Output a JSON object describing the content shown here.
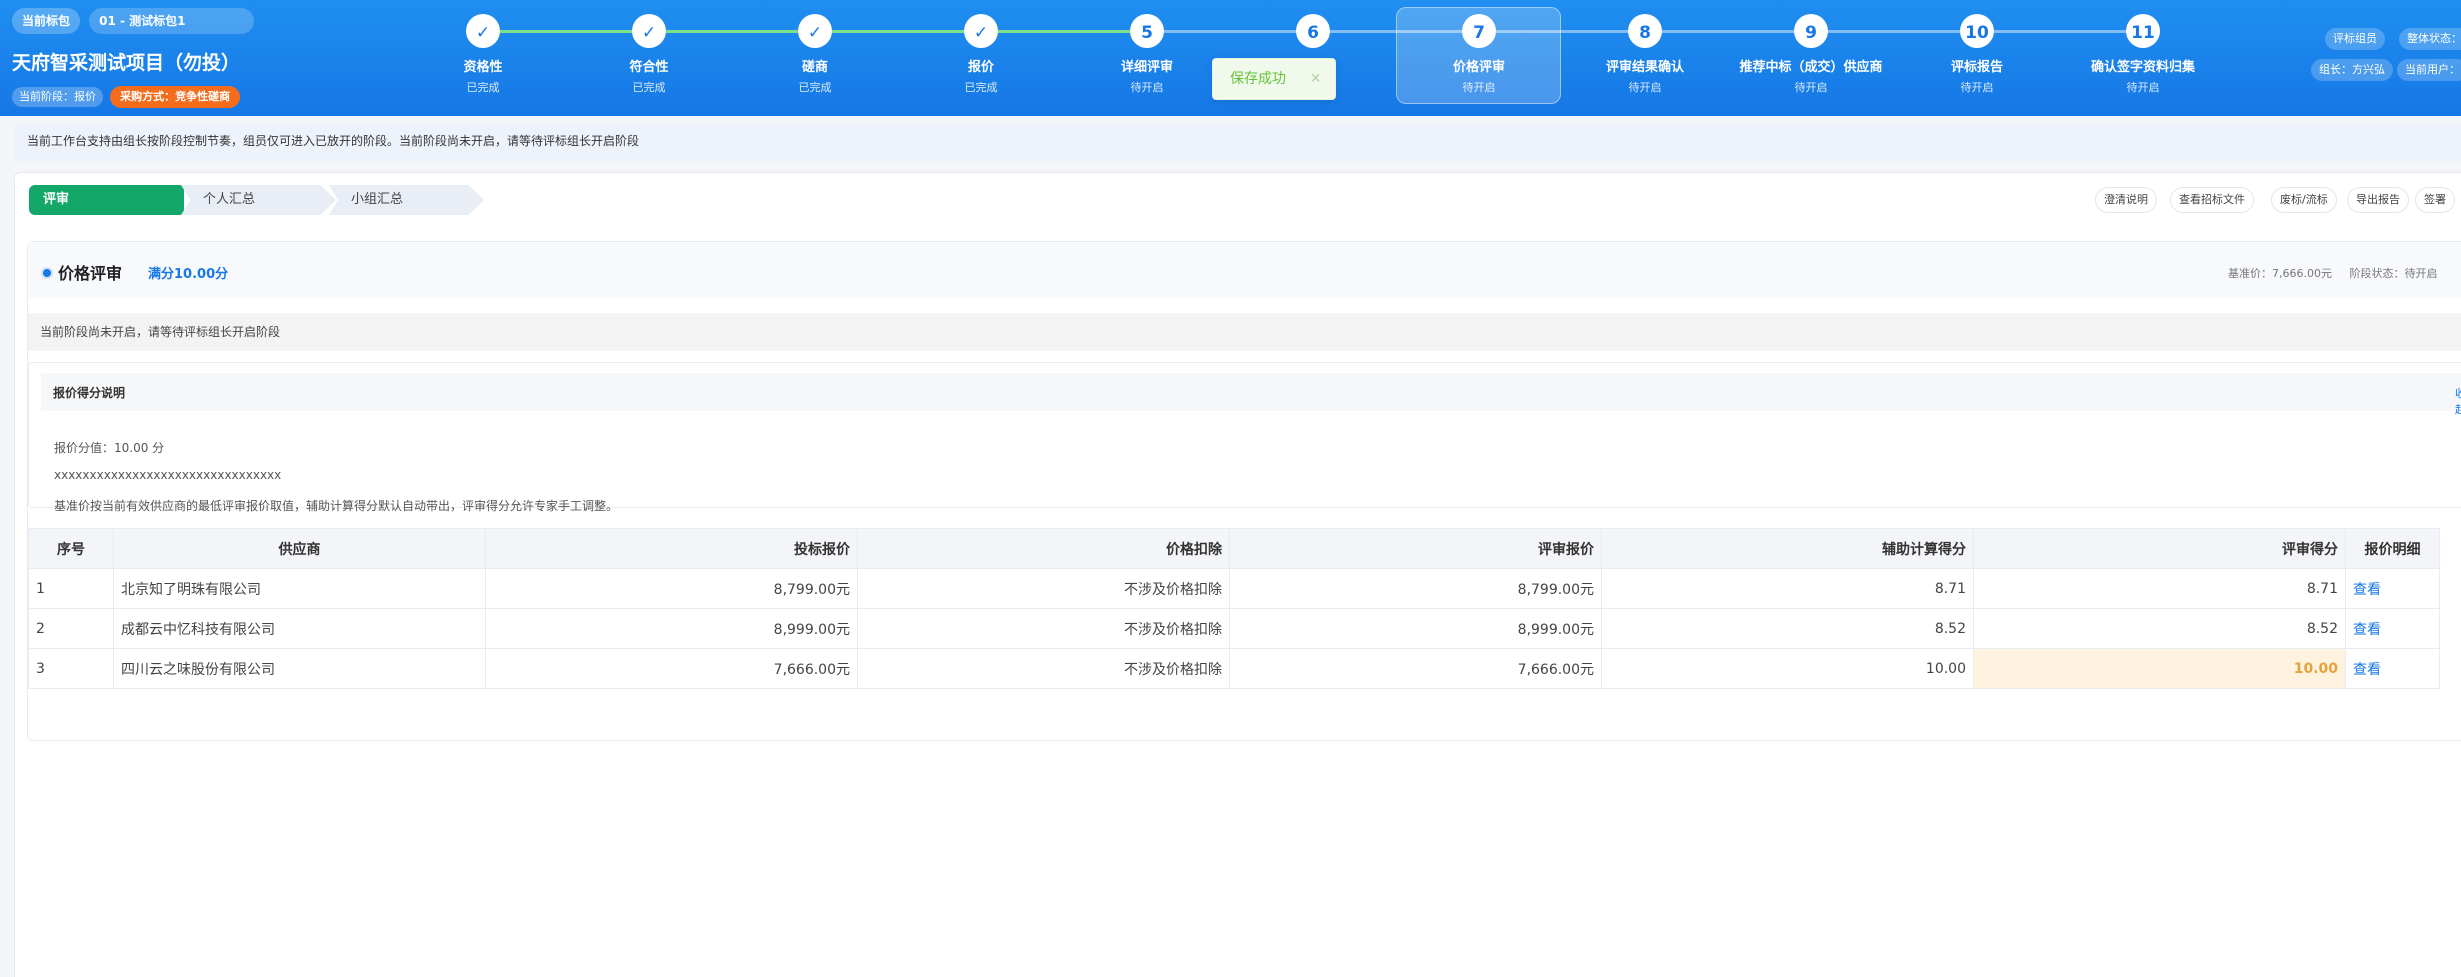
{
  "header": {
    "stage_tag": "当前标包",
    "package_label": "01 - 测试标包1",
    "project_title": "天府智采测试项目（勿投）",
    "current_stage": "当前阶段：报价",
    "method": "采购方式：竞争性磋商",
    "right": {
      "role": "评标组员",
      "overall_status": "整体状态：",
      "leader": "组长：方兴弘",
      "current_user": "当前用户："
    }
  },
  "steps": [
    {
      "num": "✓",
      "name": "资格性",
      "status": "已完成",
      "done": true
    },
    {
      "num": "✓",
      "name": "符合性",
      "status": "已完成",
      "done": true
    },
    {
      "num": "✓",
      "name": "磋商",
      "status": "已完成",
      "done": true
    },
    {
      "num": "✓",
      "name": "报价",
      "status": "已完成",
      "done": true
    },
    {
      "num": "5",
      "name": "详细评审",
      "status": "待开启",
      "done": false
    },
    {
      "num": "6",
      "name": "",
      "status": "",
      "done": false
    },
    {
      "num": "7",
      "name": "价格评审",
      "status": "待开启",
      "done": false
    },
    {
      "num": "8",
      "name": "评审结果确认",
      "status": "待开启",
      "done": false
    },
    {
      "num": "9",
      "name": "推荐中标（成交）供应商",
      "status": "待开启",
      "done": false
    },
    {
      "num": "10",
      "name": "评标报告",
      "status": "待开启",
      "done": false
    },
    {
      "num": "11",
      "name": "确认签字资料归集",
      "status": "待开启",
      "done": false
    }
  ],
  "toast": {
    "text": "保存成功",
    "close": "×"
  },
  "notice": "当前工作台支持由组长按阶段控制节奏，组员仅可进入已放开的阶段。当前阶段尚未开启，请等待评标组长开启阶段",
  "tabs": [
    "评审",
    "个人汇总",
    "小组汇总"
  ],
  "actions": [
    "澄清说明",
    "查看招标文件",
    "废标/流标",
    "导出报告",
    "签署"
  ],
  "section": {
    "title": "价格评审",
    "score": "满分10.00分",
    "base_price": "基准价：7,666.00元",
    "stage_status": "阶段状态：待开启",
    "warning": "当前阶段尚未开启，请等待评标组长开启阶段"
  },
  "explain": {
    "title": "报价得分说明",
    "collapse": "收起",
    "lines": [
      "报价分值：10.00 分",
      "xxxxxxxxxxxxxxxxxxxxxxxxxxxxxxxx",
      "基准价按当前有效供应商的最低评审报价取值，辅助计算得分默认自动带出，评审得分允许专家手工调整。"
    ]
  },
  "table": {
    "columns": [
      "序号",
      "供应商",
      "投标报价",
      "价格扣除",
      "评审报价",
      "辅助计算得分",
      "评审得分",
      "报价明细"
    ],
    "rows": [
      [
        "1",
        "北京知了明珠有限公司",
        "8,799.00元",
        "不涉及价格扣除",
        "8,799.00元",
        "8.71",
        "8.71",
        "查看"
      ],
      [
        "2",
        "成都云中忆科技有限公司",
        "8,999.00元",
        "不涉及价格扣除",
        "8,999.00元",
        "8.52",
        "8.52",
        "查看"
      ],
      [
        "3",
        "四川云之味股份有限公司",
        "7,666.00元",
        "不涉及价格扣除",
        "7,666.00元",
        "10.00",
        "10.00",
        "查看"
      ]
    ]
  }
}
